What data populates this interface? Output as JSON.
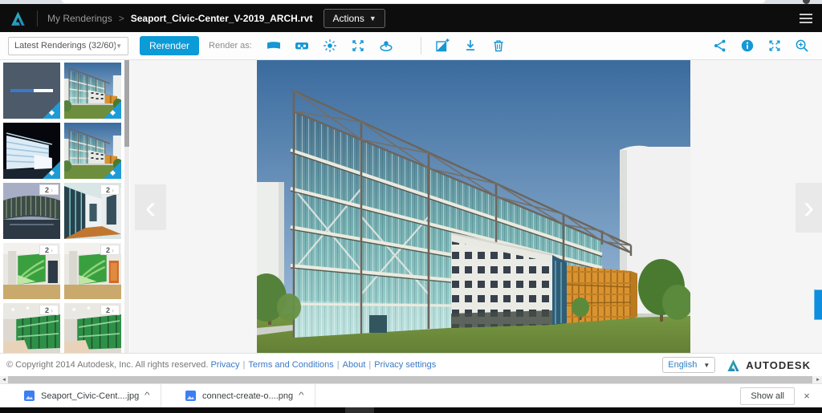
{
  "header": {
    "brand": "Autodesk",
    "breadcrumb": {
      "root": "My Renderings",
      "separator": ">",
      "current": "Seaport_Civic-Center_V-2019_ARCH.rvt"
    },
    "actions_button": {
      "label": "Actions"
    },
    "menu_icon": "hamburger-menu"
  },
  "toolbar": {
    "gallery_filter": {
      "value": "Latest Renderings  (32/60)"
    },
    "rerender_label": "Rerender",
    "render_as_label": "Render as:",
    "render_type_icons": [
      "panorama",
      "stereo-panorama",
      "solar-study",
      "interactive-panorama",
      "turntable"
    ],
    "action_icons": [
      "adjust-image",
      "download",
      "delete"
    ],
    "view_icons": [
      "share",
      "info",
      "fullscreen",
      "zoom-in"
    ],
    "accent_color": "#1598d5"
  },
  "sidebar": {
    "thumbnails": [
      {
        "name": "rendering-in-progress",
        "state": "in-progress",
        "progress_percent": 55,
        "credit_badge": true
      },
      {
        "name": "exterior-day",
        "state": "selected",
        "credit_badge": true
      },
      {
        "name": "exterior-illuminance",
        "credit_badge": true
      },
      {
        "name": "exterior-day-2",
        "credit_badge": true
      },
      {
        "name": "exterior-dusk",
        "badge_count": "2"
      },
      {
        "name": "corridor",
        "badge_count": "2"
      },
      {
        "name": "stair-interior-a",
        "badge_count": "2"
      },
      {
        "name": "stair-interior-b",
        "badge_count": "2"
      },
      {
        "name": "lobby-a",
        "badge_count": "2"
      },
      {
        "name": "lobby-b",
        "badge_count": "2"
      }
    ]
  },
  "viewer": {
    "image_description": "Seaport Civic Center exterior rendering: glass tower with steel exoskeleton cross-bracing, white office block, orange glass volume, lawn, trees, blue sky"
  },
  "footer": {
    "copyright": "© Copyright 2014 Autodesk, Inc. All rights reserved.",
    "links": [
      "Privacy",
      "Terms and Conditions",
      "About",
      "Privacy settings"
    ],
    "separator": "|",
    "language_select": {
      "value": "English"
    },
    "brand": "AUTODESK"
  },
  "downloads_bar": {
    "items": [
      {
        "name": "Seaport_Civic-Cent....jpg",
        "type": "image"
      },
      {
        "name": "connect-create-o....png",
        "type": "image"
      }
    ],
    "show_all_label": "Show all"
  },
  "icons": {
    "credit_gem": "◆",
    "badge_chevron": "›",
    "caret_down": "▼",
    "chevron_left": "‹",
    "chevron_right": "›",
    "close": "×",
    "collapse_caret": "^",
    "scroll_left": "◄",
    "scroll_right": "►"
  },
  "colors": {
    "accent_blue": "#0b9bd7",
    "header_bg": "#0d0d0d",
    "viewer_bg": "#f5f5f5",
    "selected_thumb_border": "#29abe2",
    "link_blue": "#3b78c8"
  }
}
